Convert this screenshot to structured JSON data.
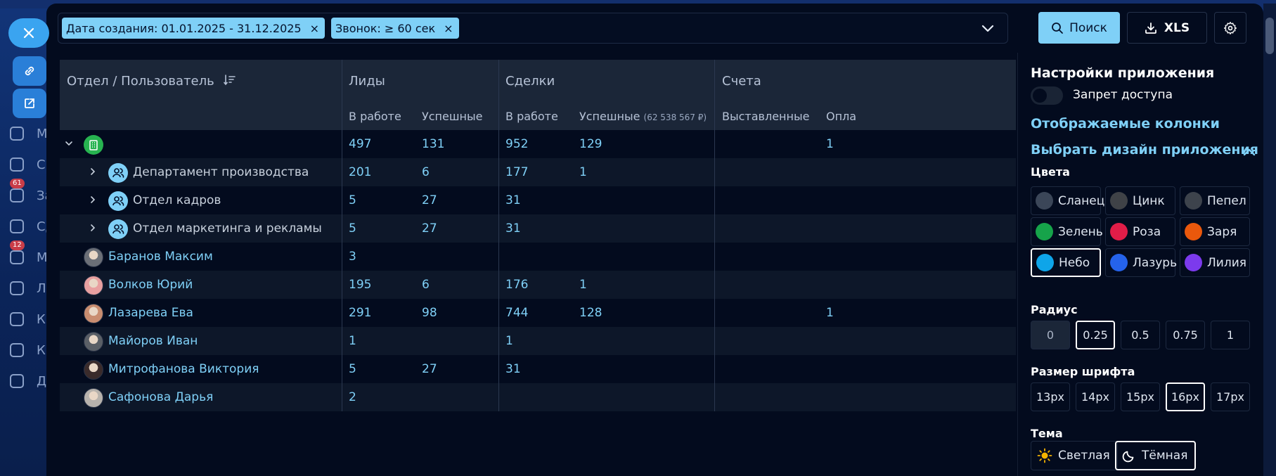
{
  "background": {
    "sidebar_items": [
      {
        "label": "М",
        "badge": ""
      },
      {
        "label": "С",
        "badge": ""
      },
      {
        "label": "За",
        "badge": "61"
      },
      {
        "label": "Сд",
        "badge": ""
      },
      {
        "label": "М",
        "badge": "12"
      },
      {
        "label": "Л",
        "badge": ""
      },
      {
        "label": "К",
        "badge": ""
      },
      {
        "label": "К",
        "badge": ""
      },
      {
        "label": "Д",
        "badge": ""
      }
    ],
    "close_label": "×"
  },
  "filters": {
    "chips": [
      {
        "label": "Дата создания: 01.01.2025 - 31.12.2025",
        "remove": "×"
      },
      {
        "label": "Звонок: ≥ 60 сек",
        "remove": "×"
      }
    ]
  },
  "toolbar": {
    "search_label": "Поиск",
    "xls_label": "XLS"
  },
  "table": {
    "header": {
      "col_name": "Отдел / Пользователь",
      "groups": [
        "Лиды",
        "Сделки",
        "Счета"
      ],
      "sub": {
        "leads_work": "В работе",
        "leads_success": "Успешные",
        "deals_work": "В работе",
        "deals_success": "Успешные",
        "deals_success_sum": "(62 538 567 ₽)",
        "invoices_issued": "Выставленные",
        "invoices_paid": "Опла"
      }
    },
    "rows": [
      {
        "type": "org",
        "name": "",
        "leads_work": "497",
        "leads_success": "131",
        "deals_work": "952",
        "deals_success": "129",
        "invoices_paid": "1"
      },
      {
        "type": "dept",
        "name": "Департамент производства",
        "leads_work": "201",
        "leads_success": "6",
        "deals_work": "177",
        "deals_success": "1",
        "invoices_paid": ""
      },
      {
        "type": "dept",
        "name": "Отдел кадров",
        "leads_work": "5",
        "leads_success": "27",
        "deals_work": "31",
        "deals_success": "",
        "invoices_paid": ""
      },
      {
        "type": "dept",
        "name": "Отдел маркетинга и рекламы",
        "leads_work": "5",
        "leads_success": "27",
        "deals_work": "31",
        "deals_success": "",
        "invoices_paid": ""
      },
      {
        "type": "user",
        "name": "Баранов Максим",
        "leads_work": "3",
        "leads_success": "",
        "deals_work": "",
        "deals_success": "",
        "invoices_paid": ""
      },
      {
        "type": "user",
        "name": "Волков Юрий",
        "leads_work": "195",
        "leads_success": "6",
        "deals_work": "176",
        "deals_success": "1",
        "invoices_paid": ""
      },
      {
        "type": "user",
        "name": "Лазарева Ева",
        "leads_work": "291",
        "leads_success": "98",
        "deals_work": "744",
        "deals_success": "128",
        "invoices_paid": "1"
      },
      {
        "type": "user",
        "name": "Майоров Иван",
        "leads_work": "1",
        "leads_success": "",
        "deals_work": "1",
        "deals_success": "",
        "invoices_paid": ""
      },
      {
        "type": "user",
        "name": "Митрофанова Виктория",
        "leads_work": "5",
        "leads_success": "27",
        "deals_work": "31",
        "deals_success": "",
        "invoices_paid": ""
      },
      {
        "type": "user",
        "name": "Сафонова Дарья",
        "leads_work": "2",
        "leads_success": "",
        "deals_work": "",
        "deals_success": "",
        "invoices_paid": ""
      }
    ]
  },
  "settings": {
    "title": "Настройки приложения",
    "access_toggle_label": "Запрет доступа",
    "columns_link": "Отображаемые колонки",
    "design_link": "Выбрать дизайн приложения",
    "colors_label": "Цвета",
    "colors": [
      {
        "name": "Сланец",
        "color": "#3b4658",
        "selected": false
      },
      {
        "name": "Цинк",
        "color": "#3f4247",
        "selected": false
      },
      {
        "name": "Пепел",
        "color": "#3d434c",
        "selected": false
      },
      {
        "name": "Зелень",
        "color": "#16a34a",
        "selected": false
      },
      {
        "name": "Роза",
        "color": "#e11d48",
        "selected": false
      },
      {
        "name": "Заря",
        "color": "#ea580c",
        "selected": false
      },
      {
        "name": "Небо",
        "color": "#0ea5e9",
        "selected": true
      },
      {
        "name": "Лазурь",
        "color": "#2563eb",
        "selected": false
      },
      {
        "name": "Лилия",
        "color": "#7c3aed",
        "selected": false
      }
    ],
    "radius_label": "Радиус",
    "radius_options": [
      {
        "label": "0",
        "selected": false,
        "dim": true
      },
      {
        "label": "0.25",
        "selected": true,
        "dim": false
      },
      {
        "label": "0.5",
        "selected": false,
        "dim": false
      },
      {
        "label": "0.75",
        "selected": false,
        "dim": false
      },
      {
        "label": "1",
        "selected": false,
        "dim": false
      }
    ],
    "font_label": "Размер шрифта",
    "font_options": [
      {
        "label": "13px",
        "selected": false
      },
      {
        "label": "14px",
        "selected": false
      },
      {
        "label": "15px",
        "selected": false
      },
      {
        "label": "16px",
        "selected": true
      },
      {
        "label": "17px",
        "selected": false
      }
    ],
    "theme_label": "Тема",
    "themes": [
      {
        "label": "Светлая",
        "icon": "sun-icon",
        "selected": false
      },
      {
        "label": "Тёмная",
        "icon": "moon-icon",
        "selected": true
      }
    ]
  }
}
